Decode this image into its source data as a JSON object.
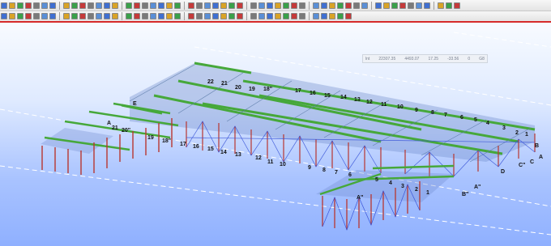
{
  "toolbar": {
    "row1_count": 60,
    "row2_count": 44,
    "accent": "#d62b2b"
  },
  "coord_display": {
    "label_left": "lnt",
    "x": "22307.35",
    "y": "4493.07",
    "z": "17.25",
    "angle": "-33.56",
    "unit": "0",
    "tag": "G8"
  },
  "grid_labels_far": [
    "1",
    "2",
    "3",
    "4",
    "5",
    "6",
    "7",
    "8",
    "9",
    "10",
    "11",
    "12",
    "13",
    "14",
    "15",
    "16",
    "17",
    "18\"",
    "19",
    "20",
    "21",
    "22"
  ],
  "grid_labels_near": [
    "1",
    "2",
    "3",
    "4",
    "5",
    "6",
    "7",
    "8",
    "9",
    "10",
    "11",
    "12",
    "13",
    "14",
    "15",
    "16",
    "17",
    "18\"",
    "19",
    "20\"",
    "21"
  ],
  "letter_labels": [
    "A",
    "B",
    "C",
    "C\"",
    "D",
    "A\"",
    "B\"",
    "E",
    "A",
    "A\""
  ],
  "colors": {
    "column": "#b8362f",
    "brace": "#3a55d8",
    "roof": "#46a83a",
    "purlin": "#5b7ba8",
    "dash": "#ffffff"
  }
}
